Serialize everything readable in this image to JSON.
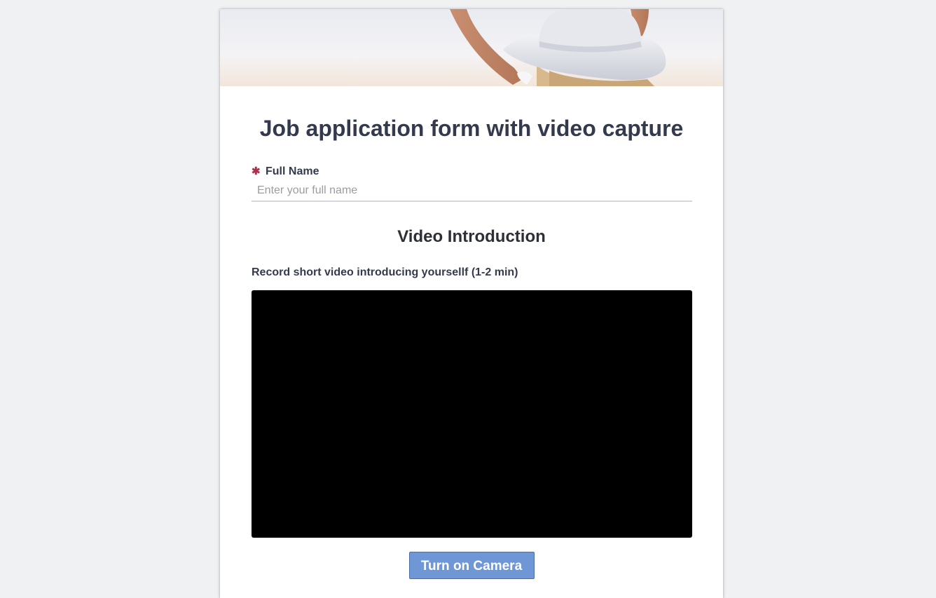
{
  "form": {
    "title": "Job application form with video capture",
    "full_name": {
      "required_mark": "✱",
      "label": "Full Name",
      "placeholder": "Enter your full name",
      "value": ""
    },
    "video_section": {
      "heading": "Video Introduction",
      "description": "Record short video introducing yoursellf (1-2 min)",
      "camera_button_label": "Turn on Camera"
    }
  },
  "colors": {
    "page_background": "#f0f1f3",
    "title_text": "#333a4d",
    "required_star": "#a4344b",
    "button_background": "#6f97d6",
    "video_background": "#000000"
  }
}
